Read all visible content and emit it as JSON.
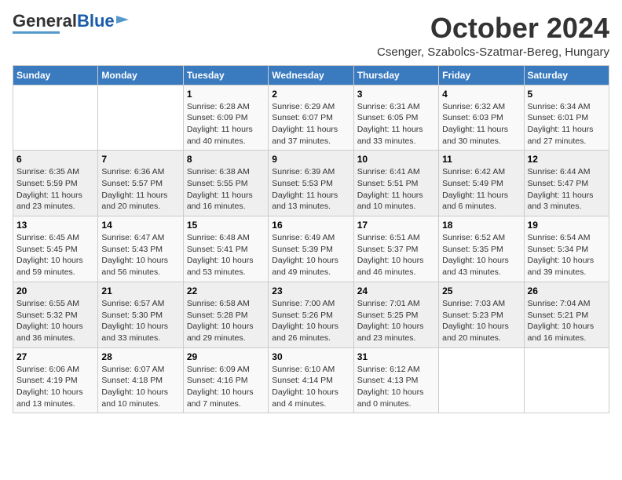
{
  "header": {
    "logo_general": "General",
    "logo_blue": "Blue",
    "month": "October 2024",
    "location": "Csenger, Szabolcs-Szatmar-Bereg, Hungary"
  },
  "days_of_week": [
    "Sunday",
    "Monday",
    "Tuesday",
    "Wednesday",
    "Thursday",
    "Friday",
    "Saturday"
  ],
  "weeks": [
    [
      {
        "day": "",
        "info": ""
      },
      {
        "day": "",
        "info": ""
      },
      {
        "day": "1",
        "info": "Sunrise: 6:28 AM\nSunset: 6:09 PM\nDaylight: 11 hours and 40 minutes."
      },
      {
        "day": "2",
        "info": "Sunrise: 6:29 AM\nSunset: 6:07 PM\nDaylight: 11 hours and 37 minutes."
      },
      {
        "day": "3",
        "info": "Sunrise: 6:31 AM\nSunset: 6:05 PM\nDaylight: 11 hours and 33 minutes."
      },
      {
        "day": "4",
        "info": "Sunrise: 6:32 AM\nSunset: 6:03 PM\nDaylight: 11 hours and 30 minutes."
      },
      {
        "day": "5",
        "info": "Sunrise: 6:34 AM\nSunset: 6:01 PM\nDaylight: 11 hours and 27 minutes."
      }
    ],
    [
      {
        "day": "6",
        "info": "Sunrise: 6:35 AM\nSunset: 5:59 PM\nDaylight: 11 hours and 23 minutes."
      },
      {
        "day": "7",
        "info": "Sunrise: 6:36 AM\nSunset: 5:57 PM\nDaylight: 11 hours and 20 minutes."
      },
      {
        "day": "8",
        "info": "Sunrise: 6:38 AM\nSunset: 5:55 PM\nDaylight: 11 hours and 16 minutes."
      },
      {
        "day": "9",
        "info": "Sunrise: 6:39 AM\nSunset: 5:53 PM\nDaylight: 11 hours and 13 minutes."
      },
      {
        "day": "10",
        "info": "Sunrise: 6:41 AM\nSunset: 5:51 PM\nDaylight: 11 hours and 10 minutes."
      },
      {
        "day": "11",
        "info": "Sunrise: 6:42 AM\nSunset: 5:49 PM\nDaylight: 11 hours and 6 minutes."
      },
      {
        "day": "12",
        "info": "Sunrise: 6:44 AM\nSunset: 5:47 PM\nDaylight: 11 hours and 3 minutes."
      }
    ],
    [
      {
        "day": "13",
        "info": "Sunrise: 6:45 AM\nSunset: 5:45 PM\nDaylight: 10 hours and 59 minutes."
      },
      {
        "day": "14",
        "info": "Sunrise: 6:47 AM\nSunset: 5:43 PM\nDaylight: 10 hours and 56 minutes."
      },
      {
        "day": "15",
        "info": "Sunrise: 6:48 AM\nSunset: 5:41 PM\nDaylight: 10 hours and 53 minutes."
      },
      {
        "day": "16",
        "info": "Sunrise: 6:49 AM\nSunset: 5:39 PM\nDaylight: 10 hours and 49 minutes."
      },
      {
        "day": "17",
        "info": "Sunrise: 6:51 AM\nSunset: 5:37 PM\nDaylight: 10 hours and 46 minutes."
      },
      {
        "day": "18",
        "info": "Sunrise: 6:52 AM\nSunset: 5:35 PM\nDaylight: 10 hours and 43 minutes."
      },
      {
        "day": "19",
        "info": "Sunrise: 6:54 AM\nSunset: 5:34 PM\nDaylight: 10 hours and 39 minutes."
      }
    ],
    [
      {
        "day": "20",
        "info": "Sunrise: 6:55 AM\nSunset: 5:32 PM\nDaylight: 10 hours and 36 minutes."
      },
      {
        "day": "21",
        "info": "Sunrise: 6:57 AM\nSunset: 5:30 PM\nDaylight: 10 hours and 33 minutes."
      },
      {
        "day": "22",
        "info": "Sunrise: 6:58 AM\nSunset: 5:28 PM\nDaylight: 10 hours and 29 minutes."
      },
      {
        "day": "23",
        "info": "Sunrise: 7:00 AM\nSunset: 5:26 PM\nDaylight: 10 hours and 26 minutes."
      },
      {
        "day": "24",
        "info": "Sunrise: 7:01 AM\nSunset: 5:25 PM\nDaylight: 10 hours and 23 minutes."
      },
      {
        "day": "25",
        "info": "Sunrise: 7:03 AM\nSunset: 5:23 PM\nDaylight: 10 hours and 20 minutes."
      },
      {
        "day": "26",
        "info": "Sunrise: 7:04 AM\nSunset: 5:21 PM\nDaylight: 10 hours and 16 minutes."
      }
    ],
    [
      {
        "day": "27",
        "info": "Sunrise: 6:06 AM\nSunset: 4:19 PM\nDaylight: 10 hours and 13 minutes."
      },
      {
        "day": "28",
        "info": "Sunrise: 6:07 AM\nSunset: 4:18 PM\nDaylight: 10 hours and 10 minutes."
      },
      {
        "day": "29",
        "info": "Sunrise: 6:09 AM\nSunset: 4:16 PM\nDaylight: 10 hours and 7 minutes."
      },
      {
        "day": "30",
        "info": "Sunrise: 6:10 AM\nSunset: 4:14 PM\nDaylight: 10 hours and 4 minutes."
      },
      {
        "day": "31",
        "info": "Sunrise: 6:12 AM\nSunset: 4:13 PM\nDaylight: 10 hours and 0 minutes."
      },
      {
        "day": "",
        "info": ""
      },
      {
        "day": "",
        "info": ""
      }
    ]
  ]
}
